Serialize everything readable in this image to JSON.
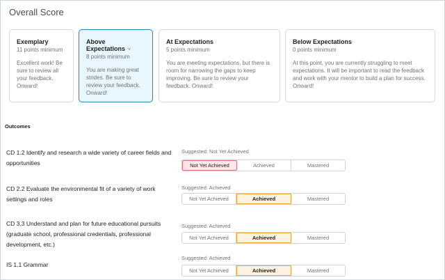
{
  "title": "Overall Score",
  "levels": [
    {
      "name": "Exemplary",
      "minimum": "11 points minimum",
      "description": "Excellent work! Be sure to review all your feedback. Onward!"
    },
    {
      "name": "Above Expectations",
      "minimum": "8 points minimum",
      "description": "You are making great strides. Be sure to review your feedback. Onward!"
    },
    {
      "name": "At Expectations",
      "minimum": "5 points minimum",
      "description": "You are meeting expectations, but there is room for narrowing the gaps to keep improving. Be sure to review your feedback. Onward!"
    },
    {
      "name": "Below Expectations",
      "minimum": "0 points minimum",
      "description": "At this point, you are currently struggling to meet expectations. It will be important to read the feedback and work with your mentor to build a plan for success. Onward!"
    }
  ],
  "selected_level_caret": "˅",
  "outcomes_heading": "Outcomes",
  "options": [
    "Not Yet Achieved",
    "Achieved",
    "Mastered"
  ],
  "outcomes": [
    {
      "name": "CD 1.2 Identify and research a wide variety of career fields and opportunities",
      "suggested": "Suggested: Not Yet Achieved",
      "selected": "Not Yet Achieved"
    },
    {
      "name": "CD 2.2 Evaluate the environmental fit of a variety of work settings and roles",
      "suggested": "Suggested: Achieved",
      "selected": "Achieved"
    },
    {
      "name": "CD 3.3 Understand and plan for future educational pursuits (graduate school, professional credentials, professional development, etc.)",
      "suggested": "Suggested: Achieved",
      "selected": "Achieved"
    },
    {
      "name": "IS 1.1 Grammar",
      "suggested": "Suggested: Achieved",
      "selected": "Achieved"
    }
  ],
  "colors": {
    "selected_level_bg": "#e8f7fd",
    "selected_level_border": "#1e87b5",
    "achieved_bg": "#fef3e0",
    "achieved_border": "#f1a73c",
    "not_yet_bg": "#fde7e9",
    "not_yet_border": "#e0707e"
  }
}
